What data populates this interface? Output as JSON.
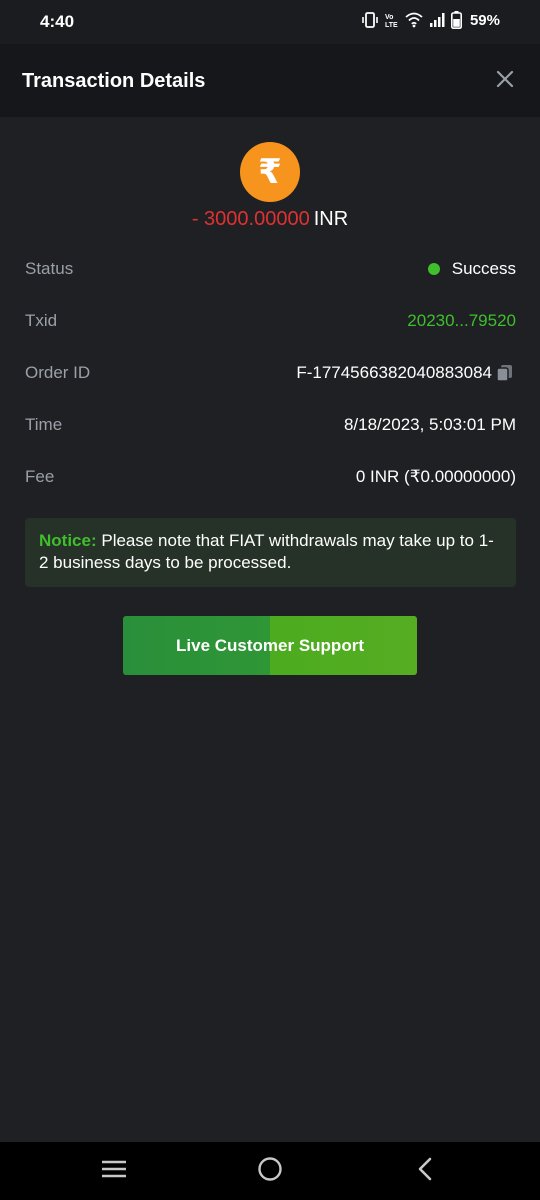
{
  "status_bar": {
    "time": "4:40",
    "battery_percent": "59%",
    "icons": [
      "vibrate-icon",
      "volte-icon",
      "wifi-icon",
      "signal-icon",
      "battery-icon"
    ]
  },
  "header": {
    "title": "Transaction Details",
    "close_icon": "close-icon"
  },
  "transaction": {
    "currency_symbol": "₹",
    "amount_sign": "-",
    "amount": "3000.00000",
    "currency": "INR",
    "rows": {
      "status": {
        "label": "Status",
        "value": "Success"
      },
      "txid": {
        "label": "Txid",
        "value": "20230...79520"
      },
      "order_id": {
        "label": "Order ID",
        "value": "F-1774566382040883084"
      },
      "time": {
        "label": "Time",
        "value": "8/18/2023, 5:03:01 PM"
      },
      "fee": {
        "label": "Fee",
        "value": "0 INR (₹0.00000000)"
      }
    }
  },
  "notice": {
    "label": "Notice:",
    "text": "Please note that FIAT withdrawals may take up to 1-2 business days to be processed."
  },
  "support_button": {
    "label": "Live Customer Support"
  },
  "colors": {
    "accent_green": "#3fbf2b",
    "amount_red": "#e03131",
    "currency_orange": "#f7941d",
    "background": "#1f2024"
  }
}
